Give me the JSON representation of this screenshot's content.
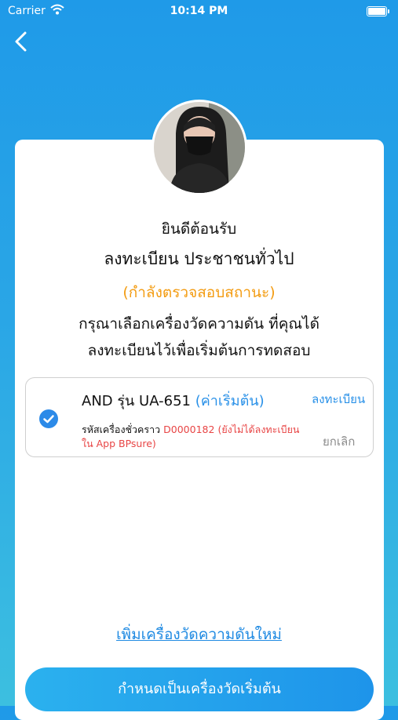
{
  "status_bar": {
    "carrier": "Carrier",
    "time": "10:14 PM"
  },
  "header": {
    "back_icon": "chevron-left-icon"
  },
  "greeting": "ยินดีต้อนรับ",
  "title": "ลงทะเบียน ประชาชนทั่วไป",
  "status": "(กำลังตรวจสอบสถานะ)",
  "instructions": {
    "line1": "กรุณาเลือกเครื่องวัดความดัน ที่คุณได้",
    "line2": "ลงทะเบียนไว้เพื่อเริ่มต้นการทดสอบ"
  },
  "device": {
    "name": "AND รุ่น UA-651",
    "default_label": "(ค่าเริ่มต้น)",
    "register_label": "ลงทะเบียน",
    "code_label": "รหัสเครื่องชั่วคราว",
    "code_value": "D0000182",
    "code_note": "(ยังไม่ได้ลงทะเบียนใน App BPsure)",
    "cancel_label": "ยกเลิก",
    "selected": true
  },
  "add_device_label": "เพิ่มเครื่องวัดความดันใหม่",
  "primary_button_label": "กำหนดเป็นเครื่องวัดเริ่มต้น",
  "colors": {
    "background_top": "#1f9ae8",
    "accent_blue": "#2a91e8",
    "status_orange": "#f39c12",
    "error_red": "#e84545",
    "muted_gray": "#8b8b8b"
  }
}
